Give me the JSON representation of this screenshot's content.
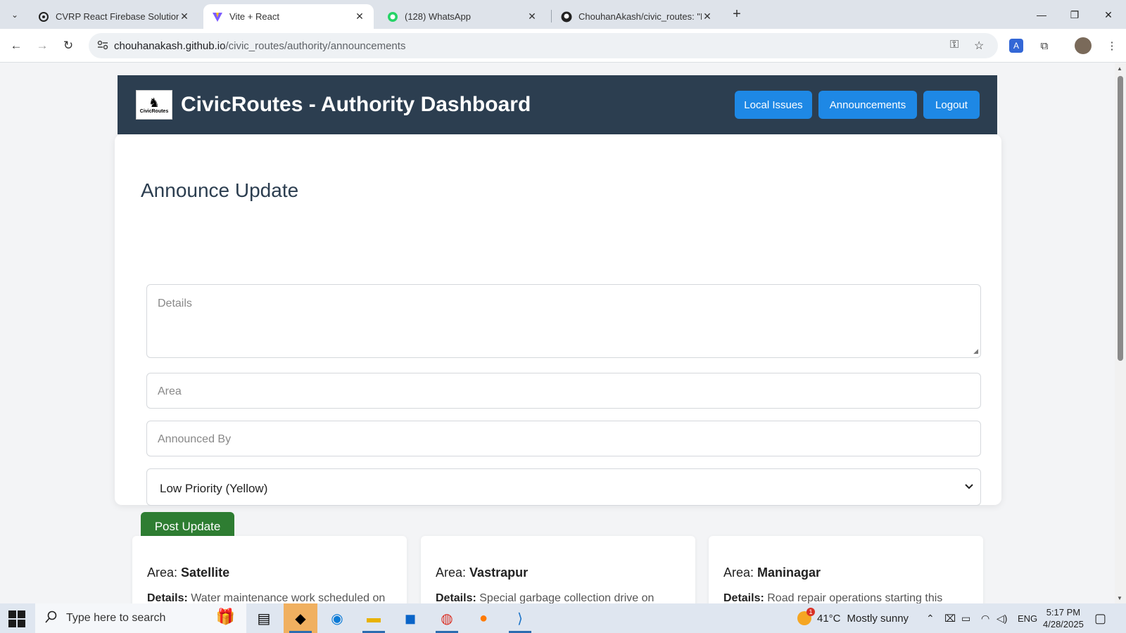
{
  "browser": {
    "tabs": [
      {
        "title": "CVRP React Firebase Solution",
        "icon": "openai-icon"
      },
      {
        "title": "Vite + React",
        "icon": "vite-icon"
      },
      {
        "title": "(128) WhatsApp",
        "icon": "whatsapp-icon"
      },
      {
        "title": "ChouhanAkash/civic_routes: \"Er",
        "icon": "github-icon"
      }
    ],
    "url_host": "chouhanakash.github.io",
    "url_path": "/civic_routes/authority/announcements"
  },
  "header": {
    "logo_text": "CivicRoutes",
    "title": "CivicRoutes - Authority Dashboard",
    "nav": {
      "local_issues": "Local Issues",
      "announcements": "Announcements",
      "logout": "Logout"
    }
  },
  "form": {
    "title": "Announce Update",
    "details_placeholder": "Details",
    "area_placeholder": "Area",
    "announced_by_placeholder": "Announced By",
    "priority_selected": "Low Priority (Yellow)",
    "submit_label": "Post Update"
  },
  "announcements": [
    {
      "area_label": "Area:",
      "area": "Satellite",
      "details_label": "Details:",
      "details": "Water maintenance work scheduled on"
    },
    {
      "area_label": "Area:",
      "area": "Vastrapur",
      "details_label": "Details:",
      "details": "Special garbage collection drive on"
    },
    {
      "area_label": "Area:",
      "area": "Maninagar",
      "details_label": "Details:",
      "details": "Road repair operations starting this"
    }
  ],
  "taskbar": {
    "search_placeholder": "Type here to search",
    "weather_temp": "41°C",
    "weather_desc": "Mostly sunny",
    "language": "ENG",
    "time": "5:17 PM",
    "date": "4/28/2025",
    "weather_alert": "1"
  },
  "colors": {
    "header_bg": "#2c3e50",
    "nav_button": "#1e88e5",
    "submit_button": "#2e7d32"
  }
}
